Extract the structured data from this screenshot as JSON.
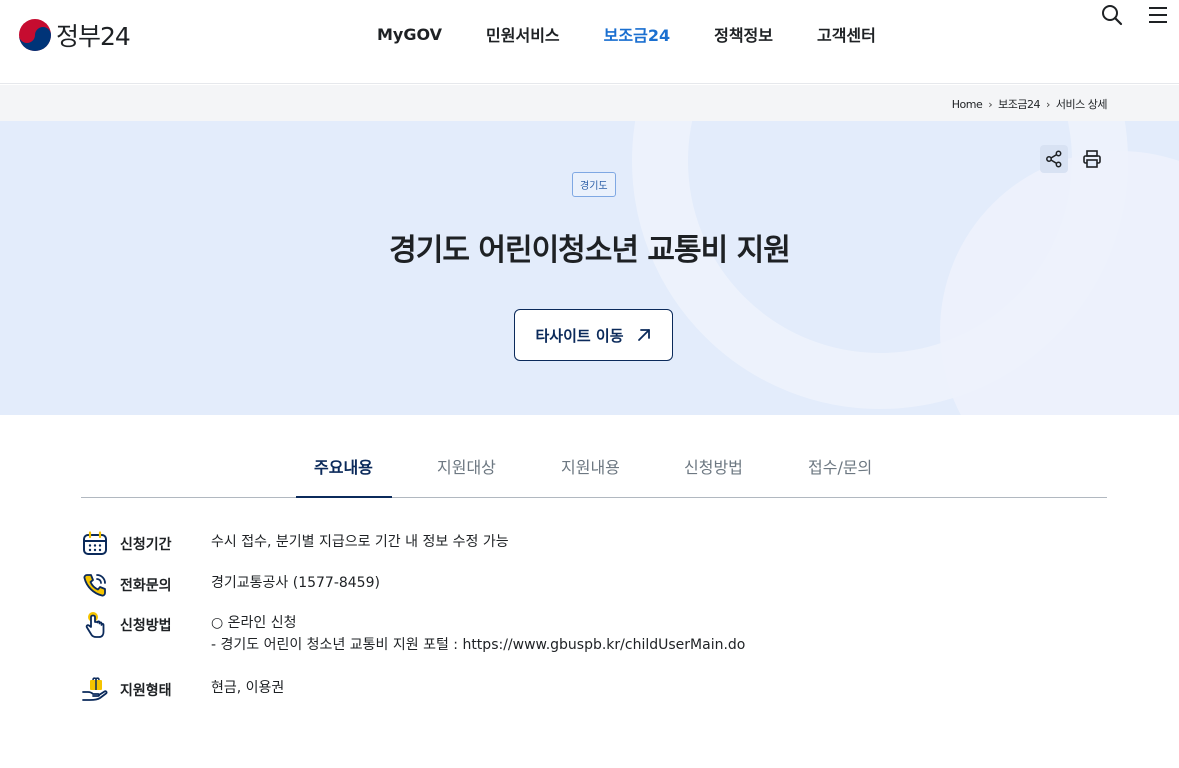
{
  "header": {
    "logo_text": "정부24",
    "nav": [
      {
        "label": "MyGOV",
        "active": false
      },
      {
        "label": "민원서비스",
        "active": false
      },
      {
        "label": "보조금24",
        "active": true
      },
      {
        "label": "정책정보",
        "active": false
      },
      {
        "label": "고객센터",
        "active": false
      }
    ],
    "icons": [
      "search-icon",
      "menu-icon"
    ]
  },
  "breadcrumb": [
    "Home",
    "보조금24",
    "서비스 상세"
  ],
  "hero": {
    "tag": "경기도",
    "title": "경기도 어린이청소년 교통비 지원",
    "site_button_label": "타사이트 이동",
    "icons": [
      "share-icon",
      "print-icon"
    ]
  },
  "tabs": [
    {
      "label": "주요내용",
      "active": true
    },
    {
      "label": "지원대상",
      "active": false
    },
    {
      "label": "지원내용",
      "active": false
    },
    {
      "label": "신청방법",
      "active": false
    },
    {
      "label": "접수/문의",
      "active": false
    }
  ],
  "info": [
    {
      "icon": "calendar-icon",
      "label": "신청기간",
      "lines": [
        "수시 접수, 분기별 지급으로 기간 내 정보 수정 가능"
      ]
    },
    {
      "icon": "phone-icon",
      "label": "전화문의",
      "lines": [
        "경기교통공사 (1577-8459)"
      ]
    },
    {
      "icon": "pointer-hand-icon",
      "label": "신청방법",
      "lines": [
        "○ 온라인 신청",
        "- 경기도 어린이 청소년 교통비 지원 포털 : https://www.gbuspb.kr/childUserMain.do"
      ]
    },
    {
      "icon": "hand-gift-icon",
      "label": "지원형태",
      "lines": [
        "현금, 이용권"
      ]
    }
  ],
  "colors": {
    "accent": "#1a6fd0",
    "navy": "#0b2a5b",
    "hero_bg": "#e3ecfb",
    "icon_yellow": "#f5c400"
  }
}
